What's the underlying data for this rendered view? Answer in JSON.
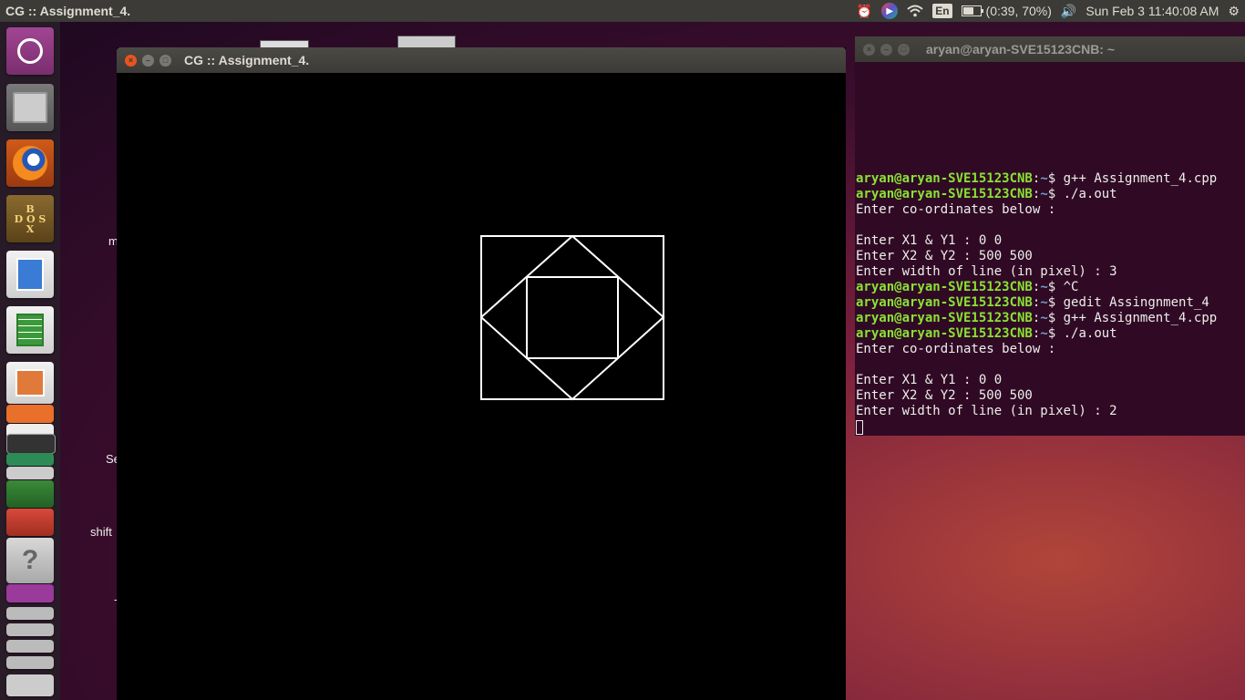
{
  "topbar": {
    "app_title": "CG :: Assignment_4.",
    "battery": "(0:39, 70%)",
    "keyboard_layout": "En",
    "clock": "Sun Feb  3 11:40:08 AM",
    "battery_level": 0.7
  },
  "desktop": {
    "labels": [
      "m",
      "Se",
      "shift",
      "-"
    ]
  },
  "cg_window": {
    "title": "CG :: Assignment_4.",
    "drawing_color": "#ffffff",
    "background": "#000000"
  },
  "terminal": {
    "title": "aryan@aryan-SVE15123CNB: ~",
    "prompt_user": "aryan@aryan-SVE15123CNB",
    "prompt_dir": "~",
    "lines": [
      {
        "type": "cmd",
        "text": " g++ Assignment_4.cpp"
      },
      {
        "type": "cmd",
        "text": " ./a.out"
      },
      {
        "type": "out",
        "text": "Enter co-ordinates below :"
      },
      {
        "type": "out",
        "text": ""
      },
      {
        "type": "out",
        "text": "Enter X1 & Y1 : 0 0"
      },
      {
        "type": "out",
        "text": "Enter X2 & Y2 : 500 500"
      },
      {
        "type": "out",
        "text": "Enter width of line (in pixel) : 3"
      },
      {
        "type": "cmd",
        "text": " ^C"
      },
      {
        "type": "cmd",
        "text": " gedit Assingnment_4"
      },
      {
        "type": "cmd",
        "text": " g++ Assignment_4.cpp"
      },
      {
        "type": "cmd",
        "text": " ./a.out"
      },
      {
        "type": "out",
        "text": "Enter co-ordinates below :"
      },
      {
        "type": "out",
        "text": ""
      },
      {
        "type": "out",
        "text": "Enter X1 & Y1 : 0 0"
      },
      {
        "type": "out",
        "text": "Enter X2 & Y2 : 500 500"
      },
      {
        "type": "out",
        "text": "Enter width of line (in pixel) : 2"
      }
    ]
  },
  "launcher": {
    "items": [
      {
        "name": "ubuntu-dash-icon"
      },
      {
        "name": "files-icon"
      },
      {
        "name": "firefox-icon"
      },
      {
        "name": "dosbox-icon"
      },
      {
        "name": "libreoffice-draw-icon"
      },
      {
        "name": "libreoffice-calc-icon"
      },
      {
        "name": "libreoffice-impress-icon"
      },
      {
        "name": "help-icon"
      }
    ]
  }
}
